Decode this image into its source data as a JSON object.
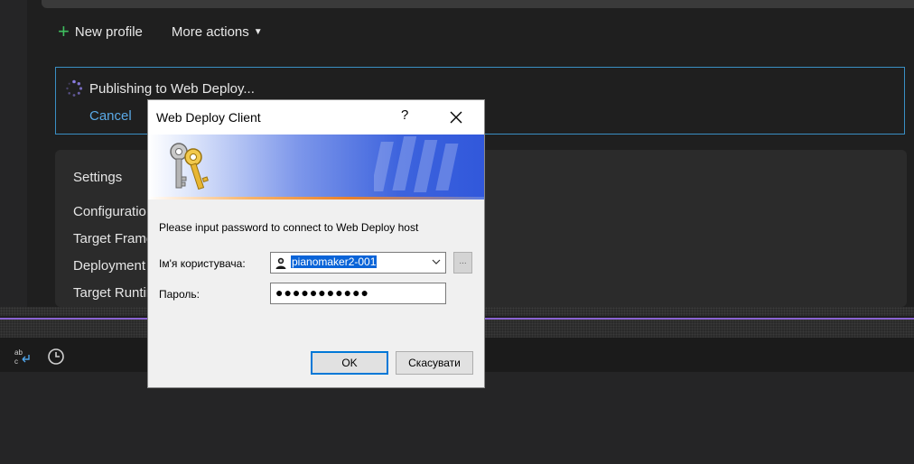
{
  "toolbar": {
    "new_profile_label": "New profile",
    "more_actions_label": "More actions"
  },
  "publish": {
    "status_text": "Publishing to Web Deploy...",
    "cancel_label": "Cancel"
  },
  "settings": {
    "title": "Settings",
    "rows": [
      "Configuratio",
      "Target Frame",
      "Deployment",
      "Target Runtin"
    ]
  },
  "dialog": {
    "title": "Web Deploy Client",
    "help_label": "?",
    "message": "Please input password to connect to Web Deploy host",
    "username_label": "Ім'я користувача:",
    "username_value": "pianomaker2-001",
    "browse_label": "...",
    "password_label": "Пароль:",
    "password_mask": "●●●●●●●●●●●",
    "ok_label": "OK",
    "cancel_label": "Скасувати"
  },
  "colors": {
    "accent_blue": "#0078d7",
    "link_blue": "#5aa9e6",
    "plus_green": "#3fbf5f",
    "divider_purple": "#8a63d2"
  }
}
